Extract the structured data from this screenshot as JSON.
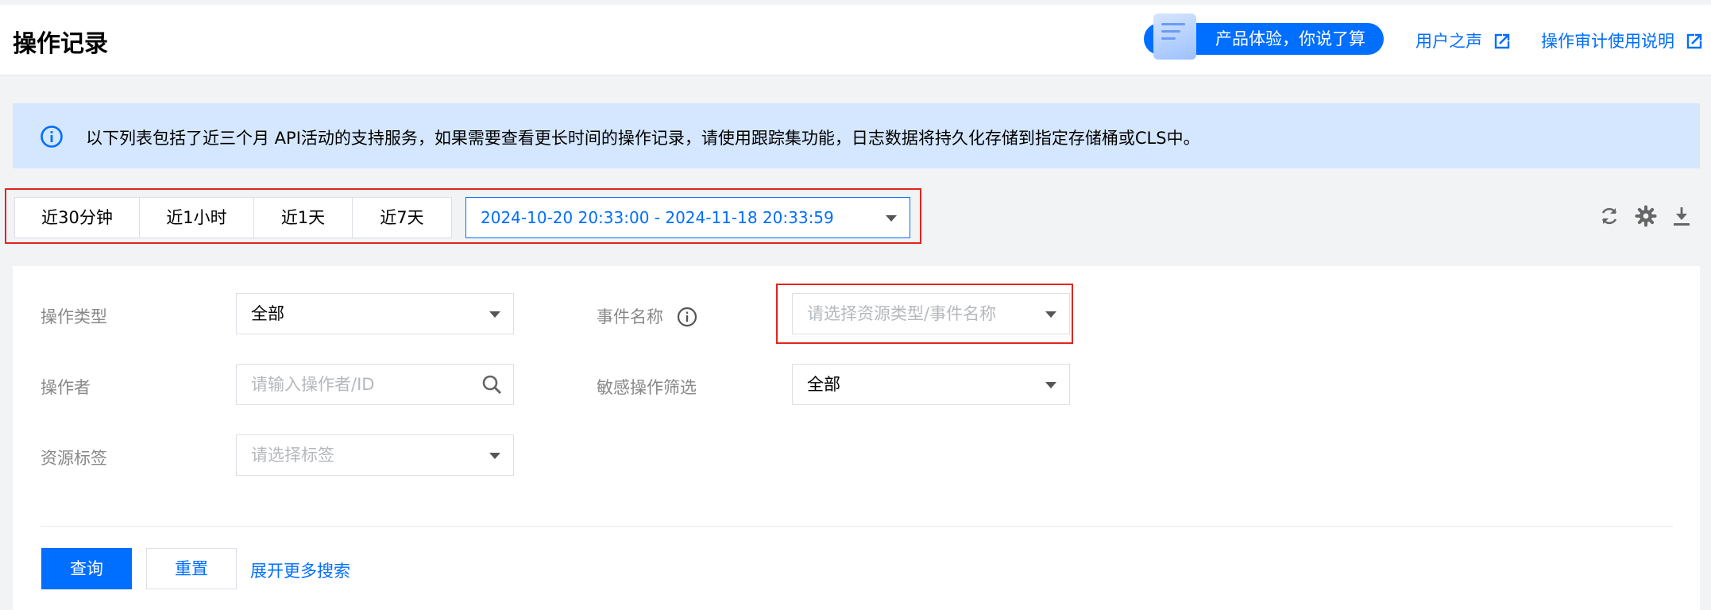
{
  "header": {
    "title": "操作记录",
    "feedback_label": "产品体验，你说了算",
    "links": [
      "用户之声",
      "操作审计使用说明"
    ]
  },
  "notice": {
    "text": "以下列表包括了近三个月 API活动的支持服务，如果需要查看更长时间的操作记录，请使用跟踪集功能，日志数据将持久化存储到指定存储桶或CLS中。"
  },
  "toolbar": {
    "quick_ranges": [
      "近30分钟",
      "近1小时",
      "近1天",
      "近7天"
    ],
    "date_range": "2024-10-20 20:33:00 - 2024-11-18 20:33:59"
  },
  "filters": {
    "op_type": {
      "label": "操作类型",
      "value": "全部"
    },
    "event_name": {
      "label": "事件名称",
      "placeholder": "请选择资源类型/事件名称"
    },
    "operator": {
      "label": "操作者",
      "placeholder": "请输入操作者/ID"
    },
    "sensitive": {
      "label": "敏感操作筛选",
      "value": "全部"
    },
    "resource_tag": {
      "label": "资源标签",
      "placeholder": "请选择标签"
    }
  },
  "actions": {
    "query": "查询",
    "reset": "重置",
    "more": "展开更多搜索"
  },
  "colors": {
    "primary": "#006eff",
    "notice_bg": "#d5e7ff",
    "highlight": "#e1251b"
  }
}
